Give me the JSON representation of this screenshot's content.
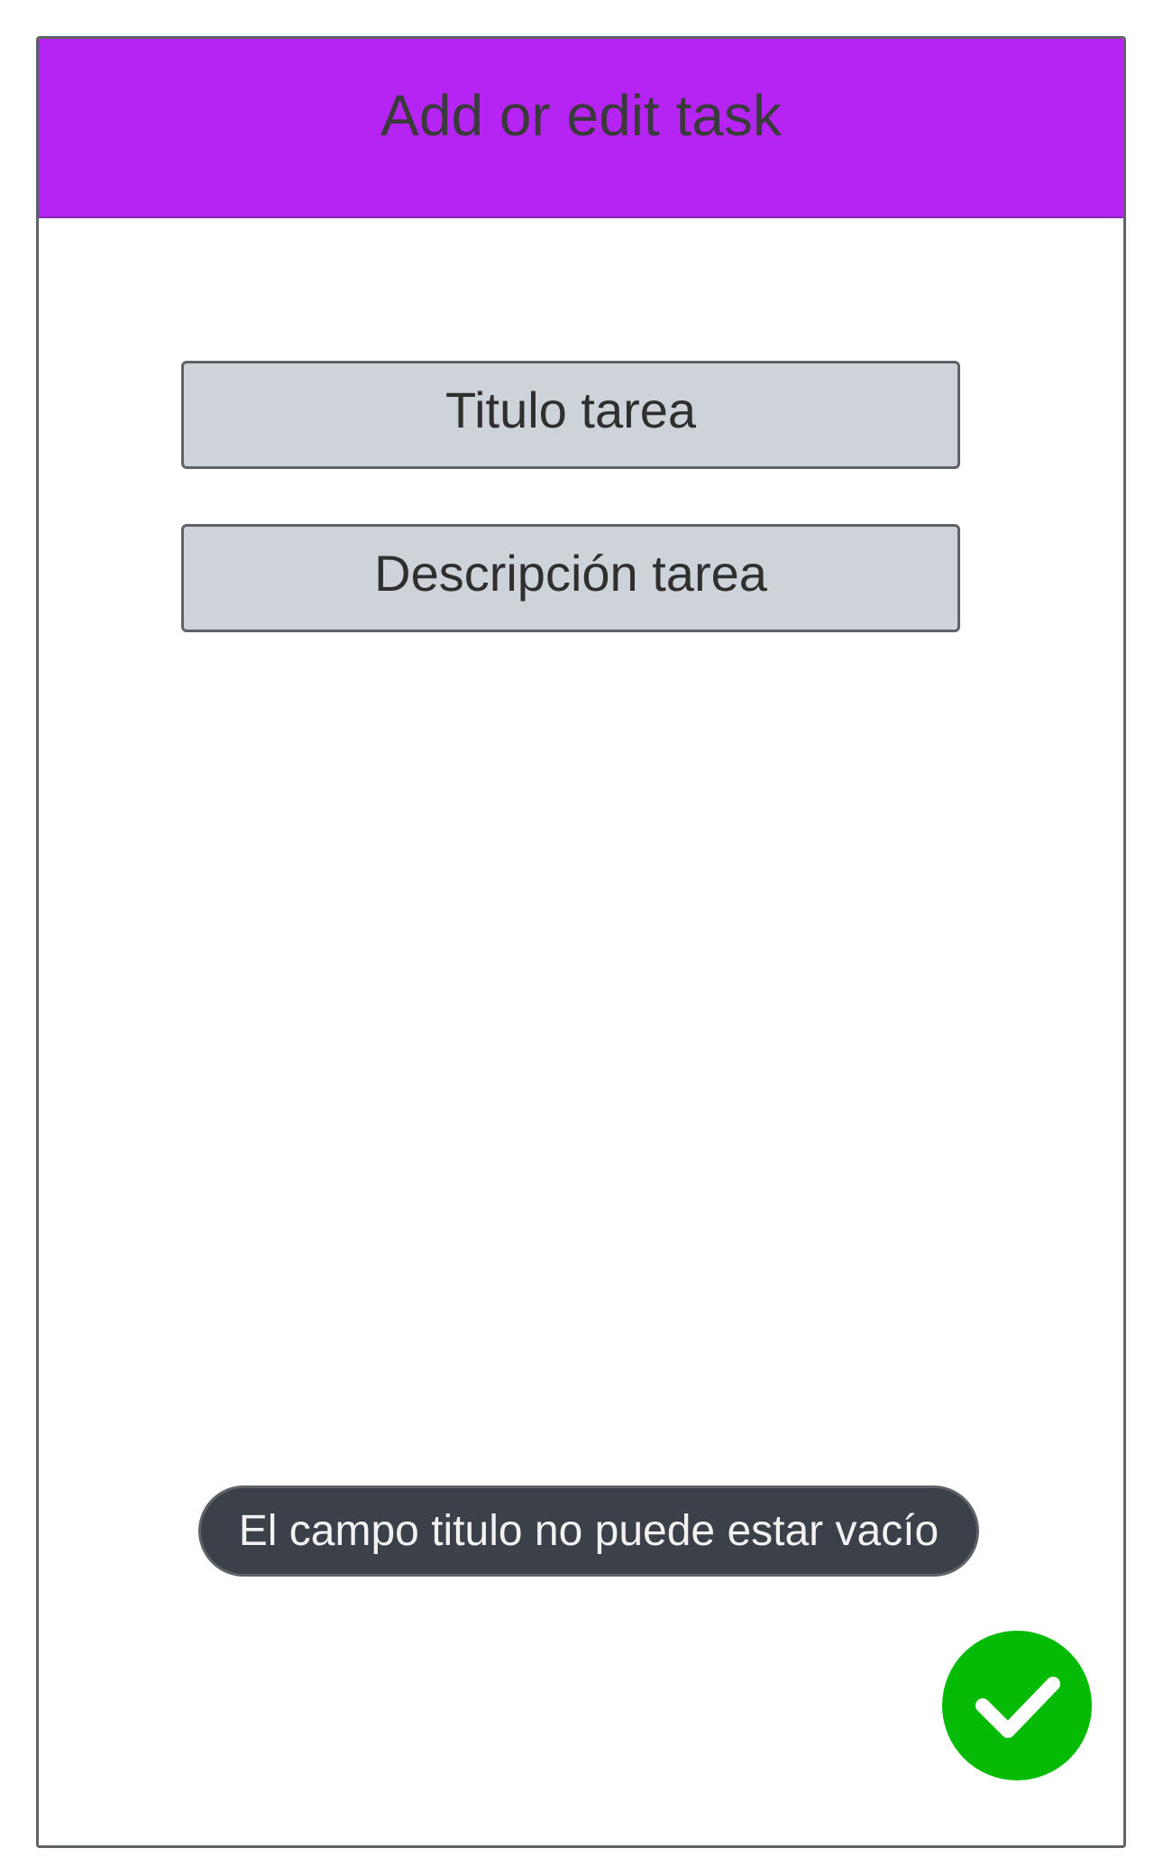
{
  "header": {
    "title": "Add or edit task",
    "background_color": "#b624f4"
  },
  "form": {
    "title_field": {
      "value": "",
      "placeholder": "Titulo tarea"
    },
    "description_field": {
      "value": "",
      "placeholder": "Descripción tarea"
    }
  },
  "toast": {
    "message": "El campo titulo no puede estar vacío",
    "background_color": "#3b4049"
  },
  "fab": {
    "icon": "checkmark-icon",
    "color": "#05bb05"
  }
}
